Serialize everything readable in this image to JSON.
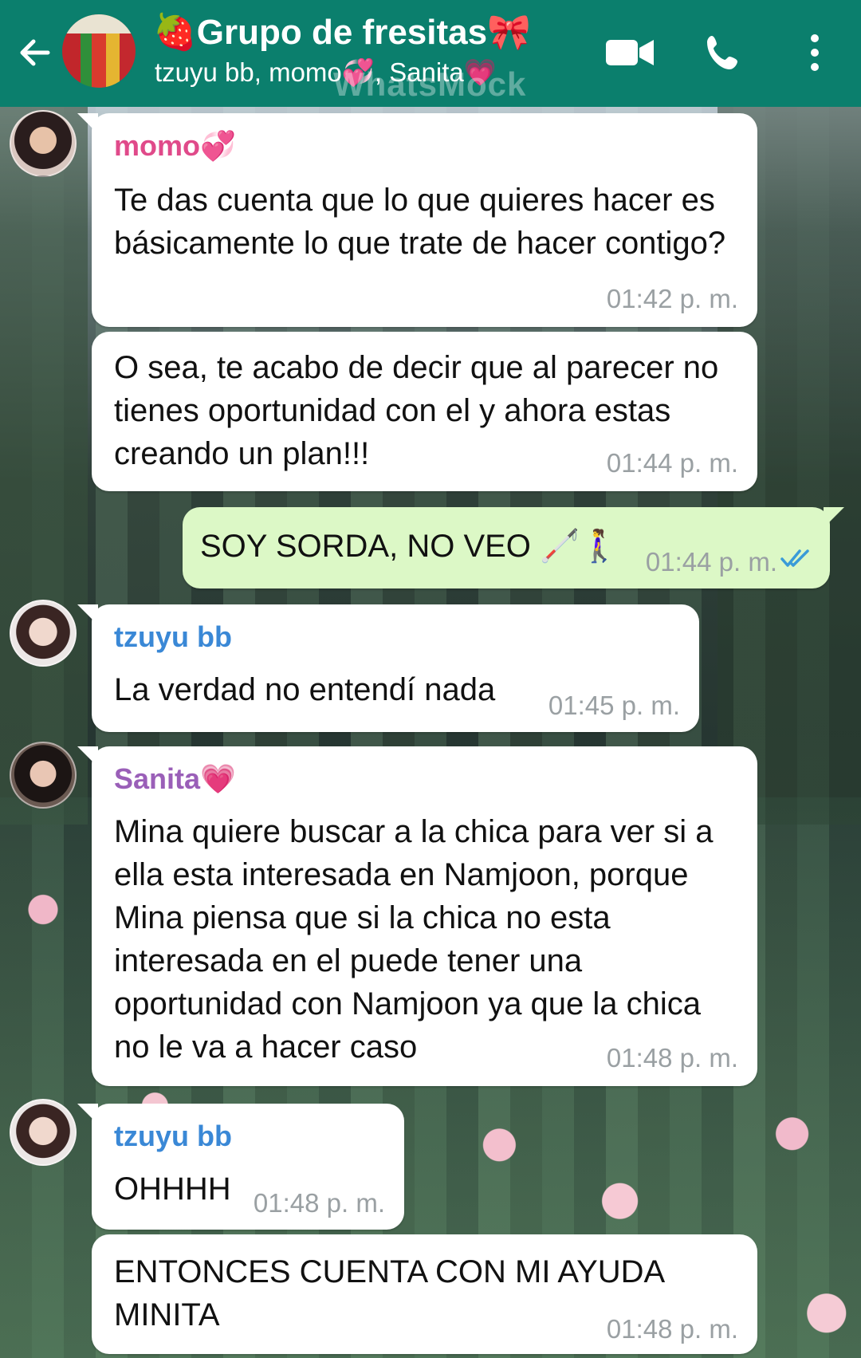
{
  "header": {
    "title": "🍓Grupo de fresitas🎀",
    "subtitle": "tzuyu bb, momo💞, Sanita💗",
    "watermark": "WhatsMock",
    "icons": {
      "back": "back-arrow-icon",
      "video": "video-call-icon",
      "call": "phone-icon",
      "menu": "more-vert-icon"
    }
  },
  "messages": [
    {
      "sender": "momo💞",
      "text": "Te das cuenta que lo que quieres hacer es básicamente lo que trate de hacer contigo?",
      "time": "01:42 p. m."
    },
    {
      "sender": "",
      "text": "O sea, te acabo de decir que al parecer no tienes oportunidad con el y ahora estas creando un plan!!!",
      "time": "01:44 p. m."
    },
    {
      "sender": "",
      "text": "SOY SORDA, NO VEO 🦯🚶‍♀️",
      "time": "01:44 p. m.",
      "outgoing": true,
      "status": "read"
    },
    {
      "sender": "tzuyu bb",
      "text": "La verdad no entendí nada",
      "time": "01:45 p. m."
    },
    {
      "sender": "Sanita💗",
      "text": "Mina quiere buscar a la chica para ver si a ella esta interesada en Namjoon, porque Mina piensa que si la chica no esta interesada en el puede tener una oportunidad con Namjoon ya que la chica no le va a hacer caso",
      "time": "01:48 p. m."
    },
    {
      "sender": "tzuyu bb",
      "text": "OHHHH",
      "time": "01:48 p. m."
    },
    {
      "sender": "",
      "text": "ENTONCES CUENTA CON MI AYUDA MINITA",
      "time": "01:48 p. m."
    }
  ],
  "colors": {
    "header": "#0b7f6d",
    "outgoing_bubble": "#dcf8c6",
    "incoming_bubble": "#ffffff",
    "read_ticks": "#3a9bd8"
  }
}
